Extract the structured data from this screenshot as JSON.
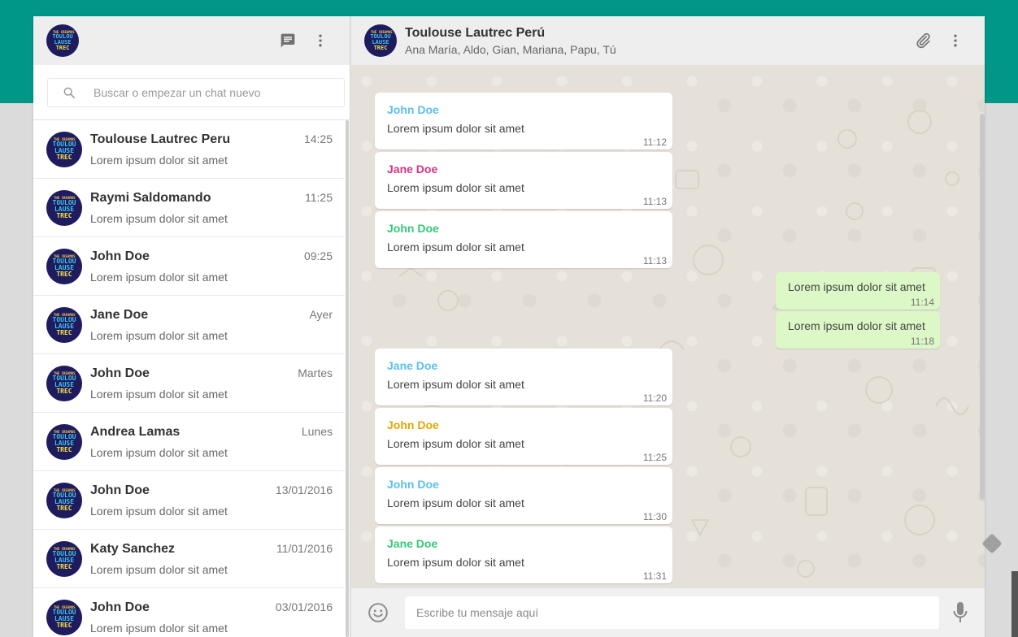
{
  "colors": {
    "brand": "#009688",
    "outgoing_bubble": "#dcf8c6",
    "background": "#dbdbdb"
  },
  "avatar_logo": {
    "line1": "THE CREAMOS",
    "line2": "TOULOU",
    "line3": "LAUSE",
    "line4": "TREC"
  },
  "sidebar": {
    "header_icons": [
      "chat-icon",
      "more-vert-icon"
    ],
    "search": {
      "placeholder": "Buscar o empezar un chat nuevo"
    },
    "chats": [
      {
        "name": "Toulouse Lautrec Peru",
        "time": "14:25",
        "preview": "Lorem ipsum dolor sit amet"
      },
      {
        "name": "Raymi Saldomando",
        "time": "11:25",
        "preview": "Lorem ipsum dolor sit amet"
      },
      {
        "name": "John Doe",
        "time": "09:25",
        "preview": "Lorem ipsum dolor sit amet"
      },
      {
        "name": "Jane Doe",
        "time": "Ayer",
        "preview": "Lorem ipsum dolor sit amet"
      },
      {
        "name": "John Doe",
        "time": "Martes",
        "preview": "Lorem ipsum dolor sit amet"
      },
      {
        "name": "Andrea Lamas",
        "time": "Lunes",
        "preview": "Lorem ipsum dolor sit amet"
      },
      {
        "name": "John Doe",
        "time": "13/01/2016",
        "preview": "Lorem ipsum dolor sit amet"
      },
      {
        "name": "Katy Sanchez",
        "time": "11/01/2016",
        "preview": "Lorem ipsum dolor sit amet"
      },
      {
        "name": "John Doe",
        "time": "03/01/2016",
        "preview": "Lorem ipsum dolor sit amet"
      }
    ]
  },
  "conversation": {
    "title": "Toulouse Lautrec Perú",
    "members": "Ana María, Aldo, Gian, Mariana, Papu, Tú",
    "header_icons": [
      "attach-icon",
      "more-vert-icon"
    ],
    "messages": [
      {
        "direction": "in",
        "sender": "John Doe",
        "sender_color": "#5bc0eb",
        "text": "Lorem ipsum dolor sit amet",
        "time": "11:12"
      },
      {
        "direction": "in",
        "sender": "Jane Doe",
        "sender_color": "#d63384",
        "text": "Lorem ipsum dolor sit amet",
        "time": "11:13"
      },
      {
        "direction": "in",
        "sender": "John Doe",
        "sender_color": "#35c97a",
        "text": "Lorem ipsum dolor sit amet",
        "time": "11:13"
      },
      {
        "direction": "out",
        "text": "Lorem ipsum dolor sit amet",
        "time": "11:14"
      },
      {
        "direction": "out",
        "text": "Lorem ipsum dolor sit amet",
        "time": "11:18"
      },
      {
        "direction": "in",
        "sender": "Jane Doe",
        "sender_color": "#5bc0eb",
        "text": "Lorem ipsum dolor sit amet",
        "time": "11:20"
      },
      {
        "direction": "in",
        "sender": "John Doe",
        "sender_color": "#e0a800",
        "text": "Lorem ipsum dolor sit amet",
        "time": "11:25"
      },
      {
        "direction": "in",
        "sender": "John Doe",
        "sender_color": "#5bc0eb",
        "text": "Lorem ipsum dolor sit amet",
        "time": "11:30"
      },
      {
        "direction": "in",
        "sender": "Jane Doe",
        "sender_color": "#35c97a",
        "text": "Lorem ipsum dolor sit amet",
        "time": "11:31"
      }
    ]
  },
  "composer": {
    "placeholder": "Escribe tu mensaje aquí",
    "icons": [
      "emoji-icon",
      "mic-icon"
    ]
  }
}
